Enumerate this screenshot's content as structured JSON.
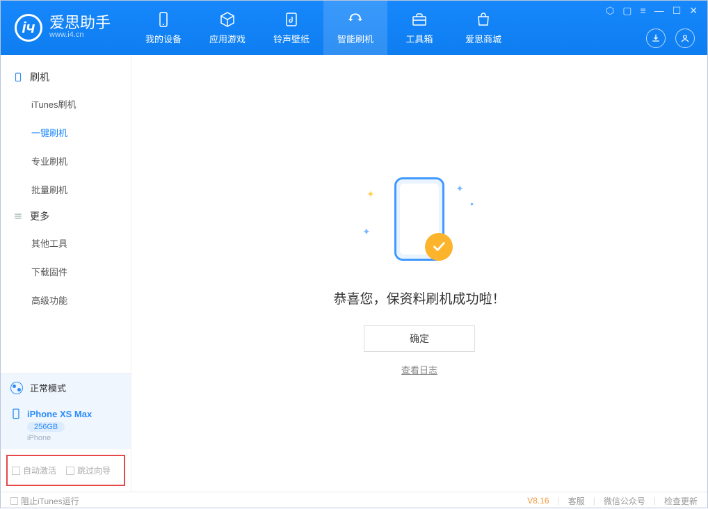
{
  "brand": {
    "name": "爱思助手",
    "url": "www.i4.cn"
  },
  "nav": {
    "device": "我的设备",
    "apps": "应用游戏",
    "ringtone": "铃声壁纸",
    "flash": "智能刷机",
    "toolbox": "工具箱",
    "store": "爱思商城"
  },
  "sidebar": {
    "group_flash": "刷机",
    "items_flash": {
      "itunes": "iTunes刷机",
      "oneclick": "一键刷机",
      "pro": "专业刷机",
      "batch": "批量刷机"
    },
    "group_more": "更多",
    "items_more": {
      "other": "其他工具",
      "firmware": "下载固件",
      "advanced": "高级功能"
    }
  },
  "mode": {
    "label": "正常模式"
  },
  "device": {
    "name": "iPhone XS Max",
    "storage": "256GB",
    "type": "iPhone"
  },
  "footer": {
    "auto_activate": "自动激活",
    "skip_guide": "跳过向导"
  },
  "result": {
    "message": "恭喜您，保资料刷机成功啦！",
    "confirm": "确定",
    "view_log": "查看日志"
  },
  "status": {
    "block_itunes": "阻止iTunes运行",
    "version": "V8.16",
    "support": "客服",
    "wechat": "微信公众号",
    "check_update": "检查更新"
  }
}
